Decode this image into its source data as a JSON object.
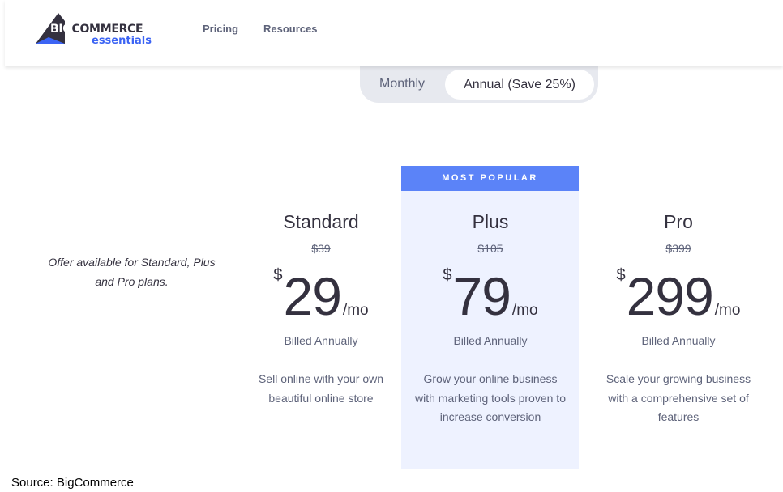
{
  "brand": {
    "logo_big": "BIG",
    "logo_commerce": "COMMERCE",
    "logo_sub": "essentials",
    "accent_color": "#3c64f4"
  },
  "nav": {
    "pricing": "Pricing",
    "resources": "Resources"
  },
  "billing_toggle": {
    "monthly": "Monthly",
    "annual": "Annual (Save 25%)",
    "selected": "annual"
  },
  "offer_note": "Offer available for Standard, Plus and Pro plans.",
  "badge": "MOST POPULAR",
  "plans": [
    {
      "name": "Standard",
      "old_price": "$39",
      "currency": "$",
      "price": "29",
      "unit": "/mo",
      "billing": "Billed Annually",
      "description": "Sell online with your own beautiful online store"
    },
    {
      "name": "Plus",
      "old_price": "$105",
      "currency": "$",
      "price": "79",
      "unit": "/mo",
      "billing": "Billed Annually",
      "description": "Grow your online business with marketing tools proven to increase conversion",
      "highlight_color": "#5b83f8"
    },
    {
      "name": "Pro",
      "old_price": "$399",
      "currency": "$",
      "price": "299",
      "unit": "/mo",
      "billing": "Billed Annually",
      "description": "Scale your growing business with a comprehensive set of features"
    }
  ],
  "source": "Source: BigCommerce"
}
